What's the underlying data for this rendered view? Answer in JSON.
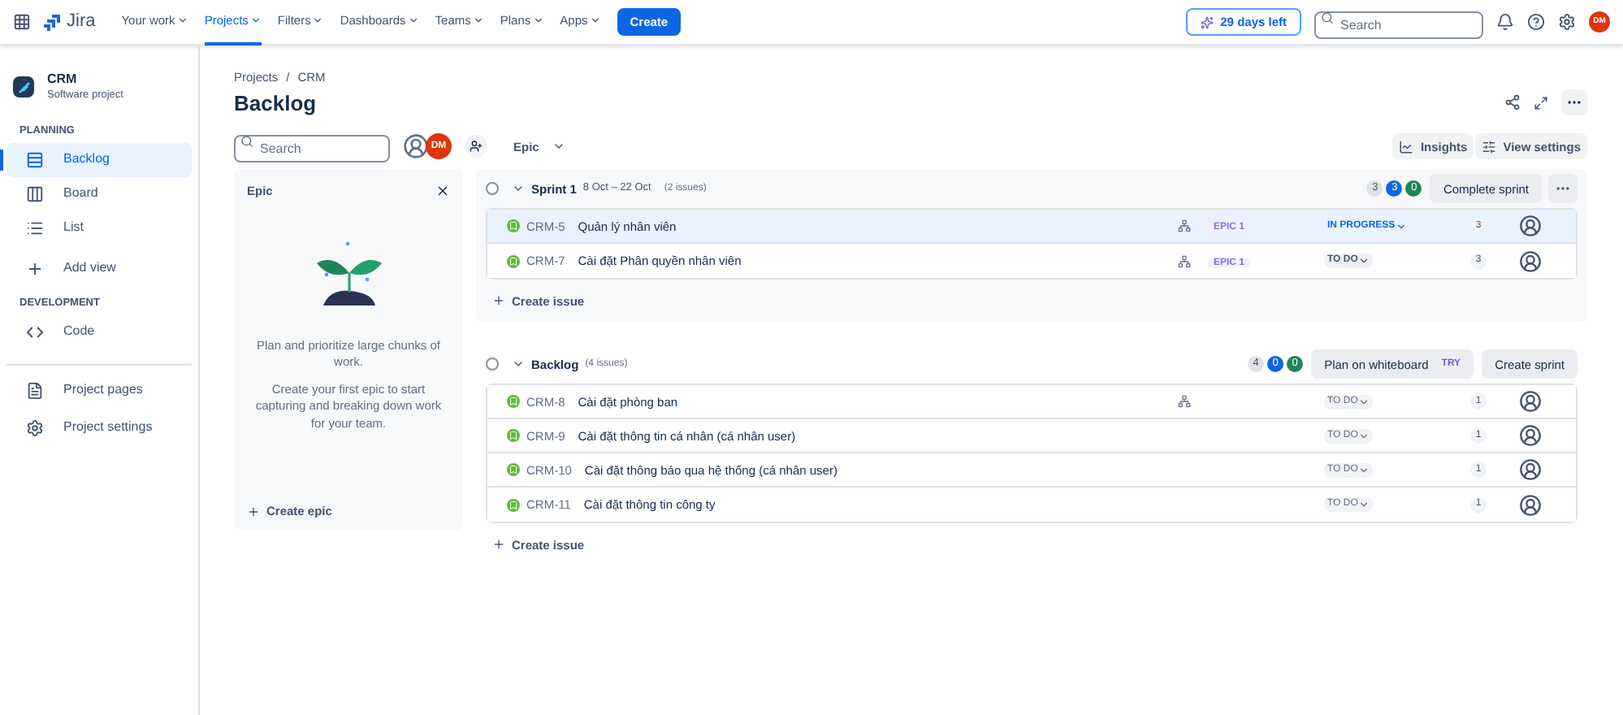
{
  "topnav": {
    "product": "Jira",
    "menus": [
      {
        "label": "Your work",
        "selected": false
      },
      {
        "label": "Projects",
        "selected": true
      },
      {
        "label": "Filters",
        "selected": false
      },
      {
        "label": "Dashboards",
        "selected": false
      },
      {
        "label": "Teams",
        "selected": false
      },
      {
        "label": "Plans",
        "selected": false
      },
      {
        "label": "Apps",
        "selected": false
      }
    ],
    "create": "Create",
    "trial": "29 days left",
    "search": {
      "placeholder": "Search"
    },
    "avatar": "DM"
  },
  "sidebar": {
    "project": {
      "name": "CRM",
      "type": "Software project"
    },
    "sections": [
      {
        "heading": "PLANNING",
        "items": [
          {
            "label": "Backlog",
            "selected": true
          },
          {
            "label": "Board",
            "selected": false
          },
          {
            "label": "List",
            "selected": false
          },
          {
            "label": "Add view",
            "selected": false
          }
        ]
      },
      {
        "heading": "DEVELOPMENT",
        "items": [
          {
            "label": "Code",
            "selected": false
          }
        ]
      }
    ],
    "footer_items": [
      {
        "label": "Project pages",
        "selected": false
      },
      {
        "label": "Project settings",
        "selected": false
      }
    ]
  },
  "breadcrumbs": [
    "Projects",
    "/",
    "CRM"
  ],
  "title": "Backlog",
  "toolbar": {
    "search": {
      "placeholder": "Search"
    },
    "avatar": "DM",
    "filter": "Epic",
    "insights": "Insights",
    "view_settings": "View settings"
  },
  "epic_panel": {
    "title": "Epic",
    "texts": [
      "Plan and prioritize large chunks of work.",
      "Create your first epic to start capturing and breaking down work for your team."
    ],
    "create": "Create epic"
  },
  "groups": [
    {
      "kind": "sprint",
      "name": "Sprint 1",
      "dates": "8 Oct – 22 Oct",
      "count": "(2 issues)",
      "checked": false,
      "counts": [
        "3",
        "3",
        "0"
      ],
      "buttons": [
        {
          "label": "Complete sprint"
        }
      ],
      "issues": [
        {
          "key": "CRM-5",
          "summary": "Quản lý nhân viên",
          "has_children": true,
          "epic": "EPIC 1",
          "status": {
            "label": "IN PROGRESS",
            "kind": "in_progress"
          },
          "points": "3",
          "selected": true
        },
        {
          "key": "CRM-7",
          "summary": "Cài đặt Phân quyền nhân viên",
          "has_children": true,
          "epic": "EPIC 1",
          "status": {
            "label": "TO DO",
            "kind": "todo_strong"
          },
          "points": "3",
          "selected": false
        }
      ],
      "create": "Create issue"
    },
    {
      "kind": "backlog",
      "name": "Backlog",
      "count": "(4 issues)",
      "checked": false,
      "counts": [
        "4",
        "0",
        "0"
      ],
      "buttons": [
        {
          "label": "Plan on whiteboard",
          "tag": "TRY"
        },
        {
          "label": "Create sprint"
        }
      ],
      "issues": [
        {
          "key": "CRM-8",
          "summary": "Cài đặt phòng ban",
          "has_children": true,
          "status": {
            "label": "TO DO",
            "kind": "todo"
          },
          "points": "1",
          "selected": false
        },
        {
          "key": "CRM-9",
          "summary": "Cài đặt thông tin cá nhân (cá nhân user)",
          "has_children": false,
          "status": {
            "label": "TO DO",
            "kind": "todo"
          },
          "points": "1",
          "selected": false
        },
        {
          "key": "CRM-10",
          "summary": "Cài đặt thông báo qua hệ thống (cá nhân user)",
          "has_children": false,
          "status": {
            "label": "TO DO",
            "kind": "todo"
          },
          "points": "1",
          "selected": false
        },
        {
          "key": "CRM-11",
          "summary": "Cài đặt thông tin công ty",
          "has_children": false,
          "status": {
            "label": "TO DO",
            "kind": "todo"
          },
          "points": "1",
          "selected": false
        }
      ],
      "create": "Create issue"
    }
  ]
}
